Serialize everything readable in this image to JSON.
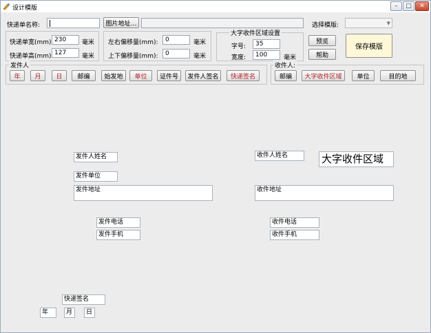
{
  "window": {
    "title": "设计模版",
    "controls": {
      "minimize": "–",
      "maximize": "□",
      "close": "✕"
    }
  },
  "top": {
    "form_name_label": "快递单名称:",
    "form_name_value": "",
    "image_button": "图片地址…",
    "image_path": "",
    "template_label": "选择模版:",
    "template_value": ""
  },
  "size": {
    "width_label": "快递单宽(mm):",
    "width_value": "230",
    "width_unit": "毫米",
    "height_label": "快递单高(mm):",
    "height_value": "127",
    "height_unit": "毫米"
  },
  "offset": {
    "lr_label": "左右偏移量(mm):",
    "lr_value": "0",
    "lr_unit": "毫米",
    "ud_label": "上下偏移量(mm):",
    "ud_value": "0",
    "ud_unit": "毫米"
  },
  "big_area": {
    "title": "大字收件区域设置",
    "font_label": "字号:",
    "font_value": "35",
    "width_label": "宽度:",
    "width_value": "100",
    "width_unit": "毫米"
  },
  "actions": {
    "preview": "预览",
    "help": "帮助",
    "save": "保存模版"
  },
  "sender_group": {
    "title": "发件人",
    "buttons": [
      "年",
      "月",
      "日",
      "邮编",
      "始发地",
      "单位",
      "证件号",
      "发件人签名",
      "快递签名"
    ]
  },
  "receiver_group": {
    "title": "收件人:",
    "buttons": [
      "邮编",
      "大字收件区域",
      "单位",
      "目的地"
    ]
  },
  "canvas": {
    "sender_name": "发件人姓名",
    "sender_company": "发件单位",
    "sender_address": "发件地址",
    "sender_phone": "发件电话",
    "sender_mobile": "发件手机",
    "receiver_name": "收件人姓名",
    "big_receiver": "大字收件区域",
    "receiver_address": "收件地址",
    "receiver_phone": "收件电话",
    "receiver_mobile": "收件手机",
    "courier_sign": "快递签名",
    "year": "年",
    "month": "月",
    "day": "日"
  },
  "colors": {
    "red_text": "#b2222a",
    "window_bg": "#ececec",
    "save_button_bg": "#fff8d8"
  }
}
